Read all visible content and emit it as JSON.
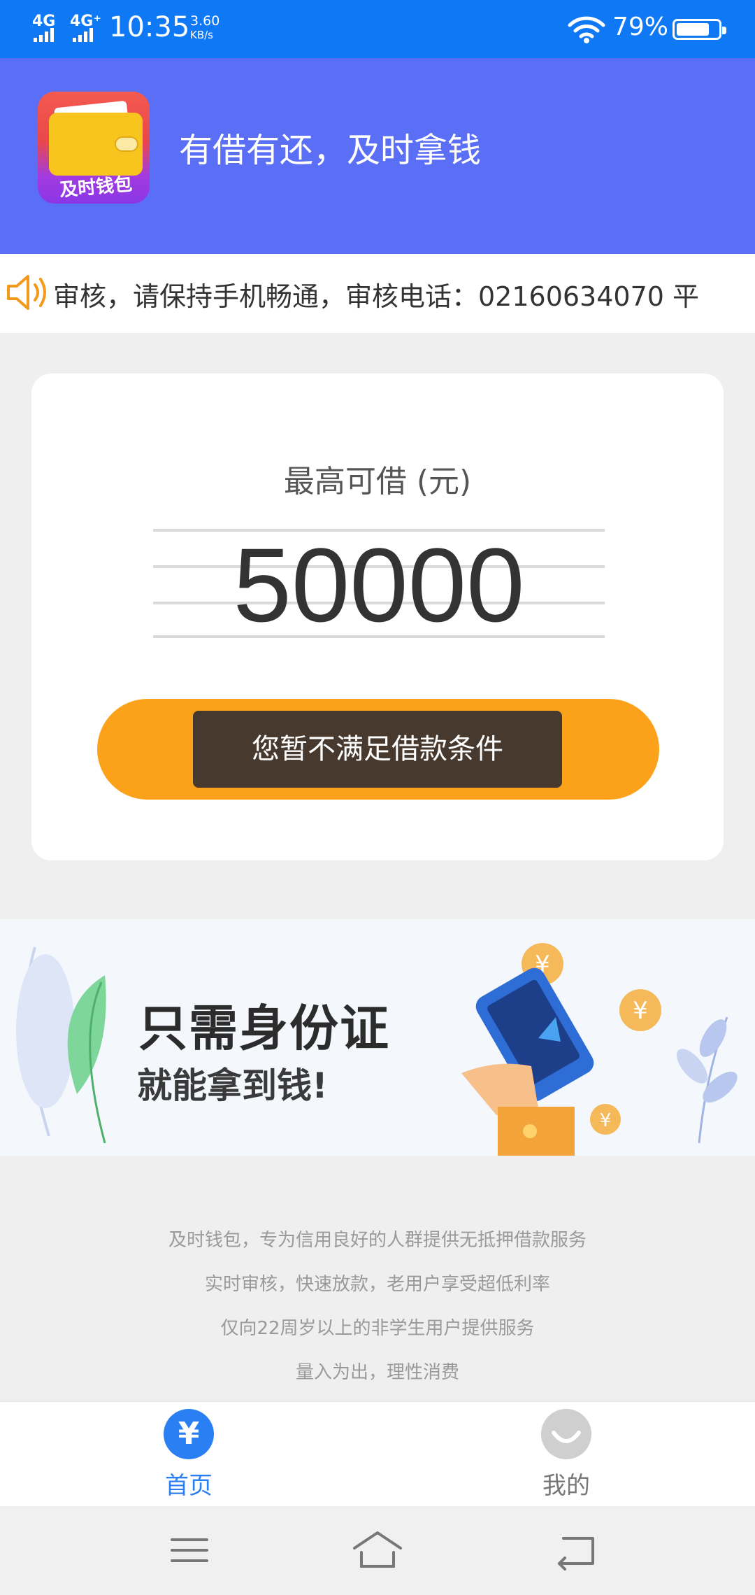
{
  "status_bar": {
    "network_1": "4G",
    "network_2": "4G⁺",
    "time": "10:35",
    "speed_value": "3.60",
    "speed_unit": "KB/s",
    "battery_percent": "79%",
    "battery_level": 0.79
  },
  "header": {
    "logo_text": "及时钱包",
    "slogan": "有借有还，及时拿钱"
  },
  "notice": {
    "text": "审核，请保持手机畅通，审核电话：02160634070 平"
  },
  "loan_card": {
    "label": "最高可借 (元)",
    "amount": "50000",
    "toast": "您暂不满足借款条件"
  },
  "banner": {
    "title": "只需身份证",
    "subtitle": "就能拿到钱!"
  },
  "info": {
    "lines": [
      "及时钱包，专为信用良好的人群提供无抵押借款服务",
      "实时审核，快速放款，老用户享受超低利率",
      "仅向22周岁以上的非学生用户提供服务",
      "量入为出，理性消费"
    ]
  },
  "tabbar": {
    "home_icon": "¥",
    "home_label": "首页",
    "mine_label": "我的"
  },
  "colors": {
    "status_bar": "#0f78f5",
    "header": "#5b6ef6",
    "button": "#fca21a",
    "tab_active": "#2a7ff3"
  }
}
